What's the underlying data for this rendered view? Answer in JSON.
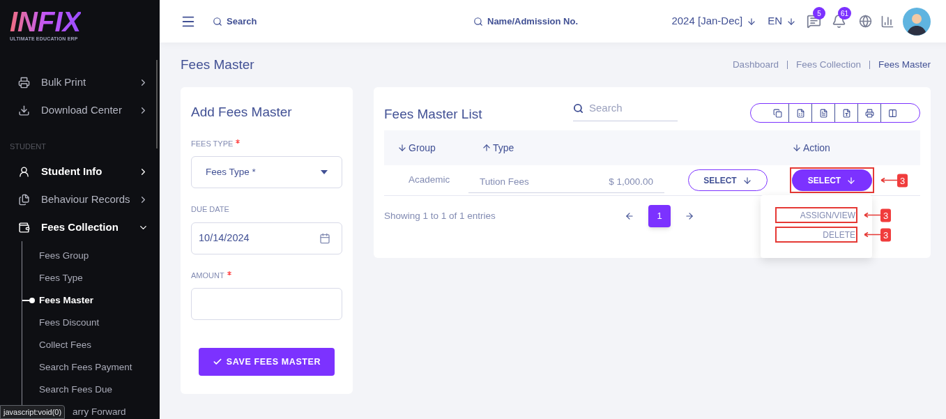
{
  "sidebar": {
    "logo": "INFIX",
    "tagline": "ULTIMATE EDUCATION ERP",
    "items": [
      {
        "kind": "print",
        "label": "Bulk Print",
        "active": false,
        "expanded": false
      },
      {
        "kind": "download",
        "label": "Download Center",
        "active": false,
        "expanded": false
      }
    ],
    "sections": [
      {
        "title": "STUDENT",
        "items": [
          {
            "kind": "student",
            "label": "Student Info",
            "active": true,
            "expanded": false
          },
          {
            "kind": "behaviour",
            "label": "Behaviour Records",
            "active": false,
            "expanded": false
          },
          {
            "kind": "fees",
            "label": "Fees Collection",
            "active": true,
            "expanded": true,
            "children": [
              {
                "label": "Fees Group",
                "selected": false
              },
              {
                "label": "Fees Type",
                "selected": false
              },
              {
                "label": "Fees Master",
                "selected": true
              },
              {
                "label": "Fees Discount",
                "selected": false
              },
              {
                "label": "Collect Fees",
                "selected": false
              },
              {
                "label": "Search Fees Payment",
                "selected": false
              },
              {
                "label": "Search Fees Due",
                "selected": false
              },
              {
                "label": "arry Forward",
                "selected": false
              }
            ]
          }
        ]
      }
    ],
    "status_tooltip": "javascript:void(0)"
  },
  "header": {
    "search_placeholder": "Search",
    "student_search_placeholder": "Name/Admission No.",
    "session": "2024 [Jan-Dec]",
    "language": "EN",
    "notifications": [
      {
        "kind": "chat",
        "count": "5"
      },
      {
        "kind": "bell",
        "count": "61"
      }
    ]
  },
  "page": {
    "title": "Fees Master",
    "breadcrumbs": [
      {
        "label": "Dashboard",
        "selected": false
      },
      {
        "label": "Fees Collection",
        "selected": false
      },
      {
        "label": "Fees Master",
        "selected": true
      }
    ]
  },
  "form": {
    "title": "Add Fees Master",
    "fields": [
      {
        "kind": "select",
        "label": "FEES TYPE",
        "required": true,
        "placeholder": "Fees Type *"
      },
      {
        "kind": "date",
        "label": "DUE DATE",
        "required": false,
        "value": "10/14/2024"
      },
      {
        "kind": "text",
        "label": "AMOUNT",
        "required": true
      }
    ],
    "submit": "SAVE FEES MASTER"
  },
  "list": {
    "title": "Fees Master List",
    "search_placeholder": "Search",
    "columns": [
      {
        "label": "Group",
        "ascending": false
      },
      {
        "label": "Type",
        "ascending": true
      },
      {
        "label": "Action",
        "ascending": false
      }
    ],
    "rows": [
      {
        "group": "Academic",
        "type": "Tution Fees",
        "amount": "$ 1,000.00",
        "select": "SELECT",
        "action": "SELECT",
        "menu_open": true,
        "annotation": "3"
      }
    ],
    "menu": [
      {
        "label": "ASSIGN/VIEW",
        "annotation": "3"
      },
      {
        "label": "DELETE",
        "annotation": "3"
      }
    ],
    "footer": "Showing 1 to 1 of 1 entries",
    "pages": [
      {
        "label": "1",
        "selected": true
      }
    ]
  }
}
